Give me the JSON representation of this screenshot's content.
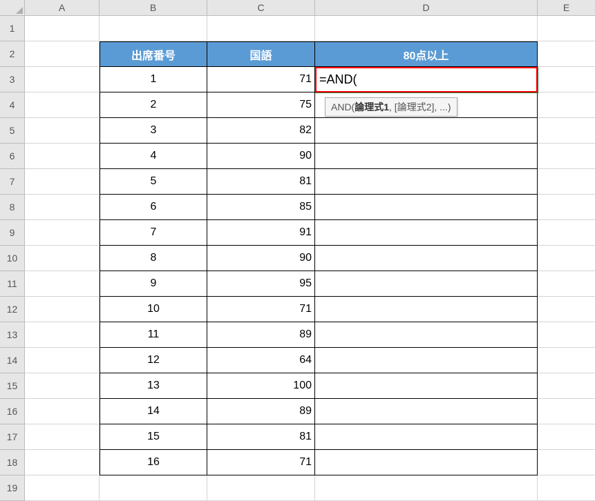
{
  "columns": [
    "A",
    "B",
    "C",
    "D",
    "E"
  ],
  "rows": [
    "1",
    "2",
    "3",
    "4",
    "5",
    "6",
    "7",
    "8",
    "9",
    "10",
    "11",
    "12",
    "13",
    "14",
    "15",
    "16",
    "17",
    "18",
    "19"
  ],
  "headers": {
    "b": "出席番号",
    "c": "国語",
    "d": "80点以上"
  },
  "data": [
    {
      "num": "1",
      "score": "71"
    },
    {
      "num": "2",
      "score": "75"
    },
    {
      "num": "3",
      "score": "82"
    },
    {
      "num": "4",
      "score": "90"
    },
    {
      "num": "5",
      "score": "81"
    },
    {
      "num": "6",
      "score": "85"
    },
    {
      "num": "7",
      "score": "91"
    },
    {
      "num": "8",
      "score": "90"
    },
    {
      "num": "9",
      "score": "95"
    },
    {
      "num": "10",
      "score": "71"
    },
    {
      "num": "11",
      "score": "89"
    },
    {
      "num": "12",
      "score": "64"
    },
    {
      "num": "13",
      "score": "100"
    },
    {
      "num": "14",
      "score": "89"
    },
    {
      "num": "15",
      "score": "81"
    },
    {
      "num": "16",
      "score": "71"
    }
  ],
  "formula": "=AND(",
  "tooltip": {
    "prefix": "AND(",
    "bold": "論理式1",
    "rest": ", [論理式2], ...)"
  }
}
